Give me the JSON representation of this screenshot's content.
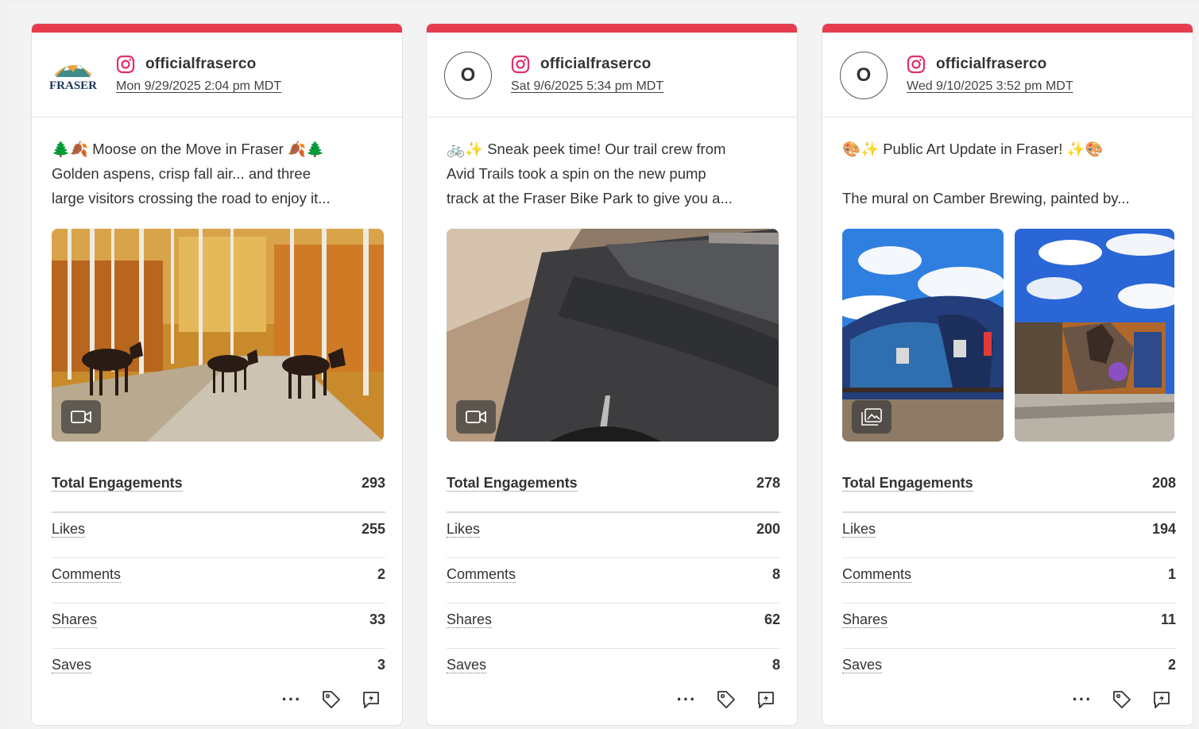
{
  "metric_labels": {
    "total": "Total Engagements",
    "likes": "Likes",
    "comments": "Comments",
    "shares": "Shares",
    "saves": "Saves"
  },
  "posts": [
    {
      "platform_icon": "instagram-icon",
      "handle": "officialfraserco",
      "avatar": "FRASER",
      "date": "Mon 9/29/2025 2:04 pm MDT",
      "caption_line1": "🌲🍂 Moose on the Move in Fraser 🍂🌲",
      "caption_line2": "Golden aspens, crisp fall air... and three",
      "caption_line3": "large visitors crossing the road to enjoy it...",
      "media_type": "video-icon",
      "metrics": {
        "total": "293",
        "likes": "255",
        "comments": "2",
        "shares": "33",
        "saves": "3"
      }
    },
    {
      "platform_icon": "instagram-icon",
      "handle": "officialfraserco",
      "avatar": "O",
      "date": "Sat 9/6/2025 5:34 pm MDT",
      "caption_line1": "🚲✨ Sneak peek time! Our trail crew from",
      "caption_line2": "Avid Trails took a spin on the new pump",
      "caption_line3": "track at the Fraser Bike Park to give you a...",
      "media_type": "video-icon",
      "metrics": {
        "total": "278",
        "likes": "200",
        "comments": "8",
        "shares": "62",
        "saves": "8"
      }
    },
    {
      "platform_icon": "instagram-icon",
      "handle": "officialfraserco",
      "avatar": "O",
      "date": "Wed 9/10/2025 3:52 pm MDT",
      "caption_line1": "🎨✨ Public Art Update in Fraser! ✨🎨",
      "caption_line2": "",
      "caption_line3": "The mural on Camber Brewing, painted by...",
      "media_type": "gallery-icon",
      "metrics": {
        "total": "208",
        "likes": "194",
        "comments": "1",
        "shares": "11",
        "saves": "2"
      }
    }
  ]
}
